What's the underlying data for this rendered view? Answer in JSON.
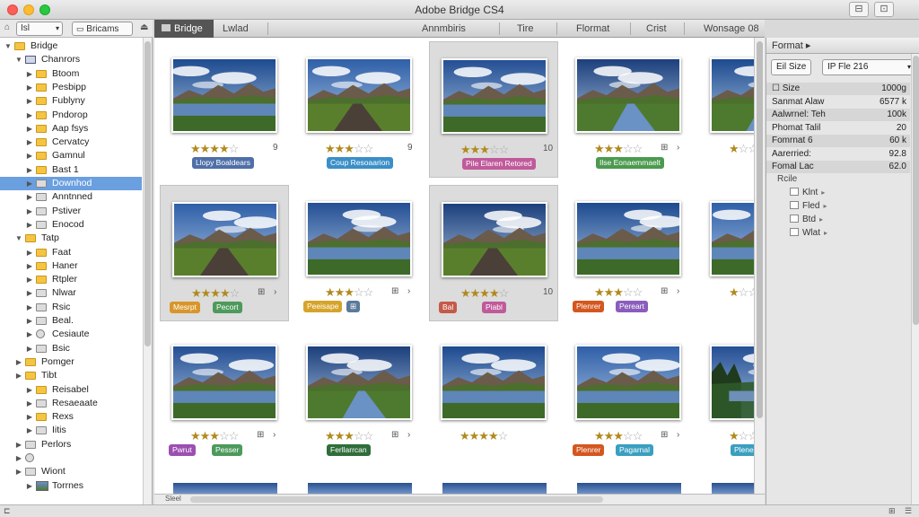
{
  "window": {
    "title": "Adobe Bridge CS4",
    "left_btn": "⊟",
    "right_btn": "⊡"
  },
  "toolbar": {
    "left_button": "Isl",
    "right_button": "Bricams",
    "left_icon": "home-icon",
    "right_icon": "folder-icon"
  },
  "tabs": {
    "active": "Bridge",
    "items": [
      "Lwlad",
      "Annmbiris",
      "Tire",
      "Flormat",
      "Crist",
      "Wonsage 08"
    ]
  },
  "tree": [
    {
      "label": "Bridge",
      "indent": 0,
      "icon": "folder",
      "expanded": true
    },
    {
      "label": "Chanrors",
      "indent": 1,
      "icon": "device",
      "expanded": true
    },
    {
      "label": "Btoom",
      "indent": 2,
      "icon": "folder"
    },
    {
      "label": "Pesbipp",
      "indent": 2,
      "icon": "folder"
    },
    {
      "label": "Fublyny",
      "indent": 2,
      "icon": "folder"
    },
    {
      "label": "Pndorop",
      "indent": 2,
      "icon": "folder"
    },
    {
      "label": "Aap fsys",
      "indent": 2,
      "icon": "folder"
    },
    {
      "label": "Cervatcy",
      "indent": 2,
      "icon": "folder"
    },
    {
      "label": "Gamnul",
      "indent": 2,
      "icon": "folder"
    },
    {
      "label": "Bast 1",
      "indent": 2,
      "icon": "folder"
    },
    {
      "label": "Downhod",
      "indent": 2,
      "icon": "folder-gray",
      "selected": true
    },
    {
      "label": "Anntnned",
      "indent": 2,
      "icon": "folder-gray"
    },
    {
      "label": "Pstiver",
      "indent": 2,
      "icon": "folder-gray"
    },
    {
      "label": "Enocod",
      "indent": 2,
      "icon": "folder-gray"
    },
    {
      "label": "Tatp",
      "indent": 1,
      "icon": "folder",
      "expanded": true
    },
    {
      "label": "Faat",
      "indent": 2,
      "icon": "folder"
    },
    {
      "label": "Haner",
      "indent": 2,
      "icon": "folder"
    },
    {
      "label": "Rtpler",
      "indent": 2,
      "icon": "folder"
    },
    {
      "label": "Nlwar",
      "indent": 2,
      "icon": "folder-gray"
    },
    {
      "label": "Rsic",
      "indent": 2,
      "icon": "folder-gray"
    },
    {
      "label": "Beal.",
      "indent": 2,
      "icon": "folder-gray"
    },
    {
      "label": "Cesiaute",
      "indent": 2,
      "icon": "disc"
    },
    {
      "label": "Bsic",
      "indent": 2,
      "icon": "folder-gray"
    },
    {
      "label": "Pomger",
      "indent": 1,
      "icon": "folder"
    },
    {
      "label": "Tibt",
      "indent": 1,
      "icon": "folder"
    },
    {
      "label": "Reisabel",
      "indent": 2,
      "icon": "folder"
    },
    {
      "label": "Resaeaate",
      "indent": 2,
      "icon": "folder-gray"
    },
    {
      "label": "Rexs",
      "indent": 2,
      "icon": "folder"
    },
    {
      "label": "Iitis",
      "indent": 2,
      "icon": "folder-gray"
    },
    {
      "label": "Perlors",
      "indent": 1,
      "icon": "folder-gray"
    },
    {
      "label": "",
      "indent": 1,
      "icon": "disc"
    },
    {
      "label": "Wiont",
      "indent": 1,
      "icon": "folder-gray"
    },
    {
      "label": "Torrnes",
      "indent": 2,
      "icon": "image"
    }
  ],
  "thumbnails": [
    {
      "stars": 4,
      "r1": "",
      "r2": "9",
      "tag": "Llopy Boaldears",
      "tag_color": "#4f6fa8",
      "scene": "lake"
    },
    {
      "stars": 3,
      "r1": "",
      "r2": "9",
      "tag": "Coup Resoaarion",
      "tag_color": "#3a8fc7",
      "scene": "road"
    },
    {
      "stars": 3,
      "r1": "",
      "r2": "10",
      "tag": "Pile Elaren Retored",
      "tag_color": "#c05a9b",
      "scene": "lake",
      "selected": true
    },
    {
      "stars": 3,
      "r1": "⊞",
      "r2": "›",
      "tag": "Ilse Eonaemmaelt",
      "tag_color": "#4c9a4f",
      "scene": "river"
    },
    {
      "stars": 1,
      "r1": "",
      "r2": "",
      "tag": "",
      "tag_color": "",
      "scene": "river"
    },
    {
      "stars": 4,
      "r1": "⊞",
      "r2": "›",
      "tag": "Mesrpt",
      "tag_color": "#d8962a",
      "tag2": "Pecort",
      "tag2_color": "#4d9a5b",
      "scene": "road",
      "selected": true
    },
    {
      "stars": 3,
      "r1": "⊞",
      "r2": "›",
      "tag": "Peeisape",
      "tag_color": "#d6a42a",
      "tag2": "⊞",
      "tag2_color": "#5a7a9a",
      "scene": "lake"
    },
    {
      "stars": 4,
      "r1": "",
      "r2": "10",
      "tag": "Bal",
      "tag_color": "#c45a48",
      "tag2": "Piabl",
      "tag2_color": "#c05a9b",
      "scene": "road",
      "selected": true
    },
    {
      "stars": 3,
      "r1": "⊞",
      "r2": "›",
      "tag": "Plenrer",
      "tag_color": "#d4571f",
      "tag2": "Pereart",
      "tag2_color": "#8a5dbd",
      "scene": "lake"
    },
    {
      "stars": 1,
      "r1": "",
      "r2": "",
      "tag": "",
      "tag_color": "",
      "scene": "lake"
    },
    {
      "stars": 3,
      "r1": "⊞",
      "r2": "›",
      "tag": "Pwrut",
      "tag_color": "#9c4fb1",
      "tag2": "Pesser",
      "tag2_color": "#4d9a5b",
      "scene": "lake"
    },
    {
      "stars": 3,
      "r1": "⊞",
      "r2": "›",
      "tag": "Ferllarrcan",
      "tag_color": "#2e6e3a",
      "scene": "river"
    },
    {
      "stars": 4,
      "r1": "",
      "r2": "",
      "tag": "",
      "tag_color": "",
      "scene": "lake"
    },
    {
      "stars": 3,
      "r1": "⊞",
      "r2": "›",
      "tag": "Plenrer",
      "tag_color": "#d4571f",
      "tag2": "Pagarnal",
      "tag2_color": "#3a9fc0",
      "scene": "lake"
    },
    {
      "stars": 1,
      "r1": "",
      "r2": "",
      "tag": "Plene",
      "tag_color": "#3a9fc0",
      "scene": "forest"
    }
  ],
  "bottom_row_label": "Sleel",
  "rpanel": {
    "header": "Format ▸",
    "btn1": "Eil Size",
    "btn2": "IP Fle 216",
    "meta": [
      {
        "k": "☐ Size",
        "v": "1000g"
      },
      {
        "k": "Sanmat Alaw",
        "v": "6577 k"
      },
      {
        "k": "Aalwrnel: Teh",
        "v": "100k"
      },
      {
        "k": "Phomat Talil",
        "v": "20"
      },
      {
        "k": "Fomrnat   6",
        "v": "60 k"
      },
      {
        "k": "Aarerried:",
        "v": "92.8"
      },
      {
        "k": "Fomal Lac",
        "v": "62.0"
      }
    ],
    "section": "Rcile",
    "keywords": [
      "Klnt",
      "Fled",
      "Btd",
      "Wlat"
    ]
  },
  "colors": {
    "selection": "#6a9fe0",
    "star": "#b08a1e",
    "folder": "#f4c543"
  }
}
